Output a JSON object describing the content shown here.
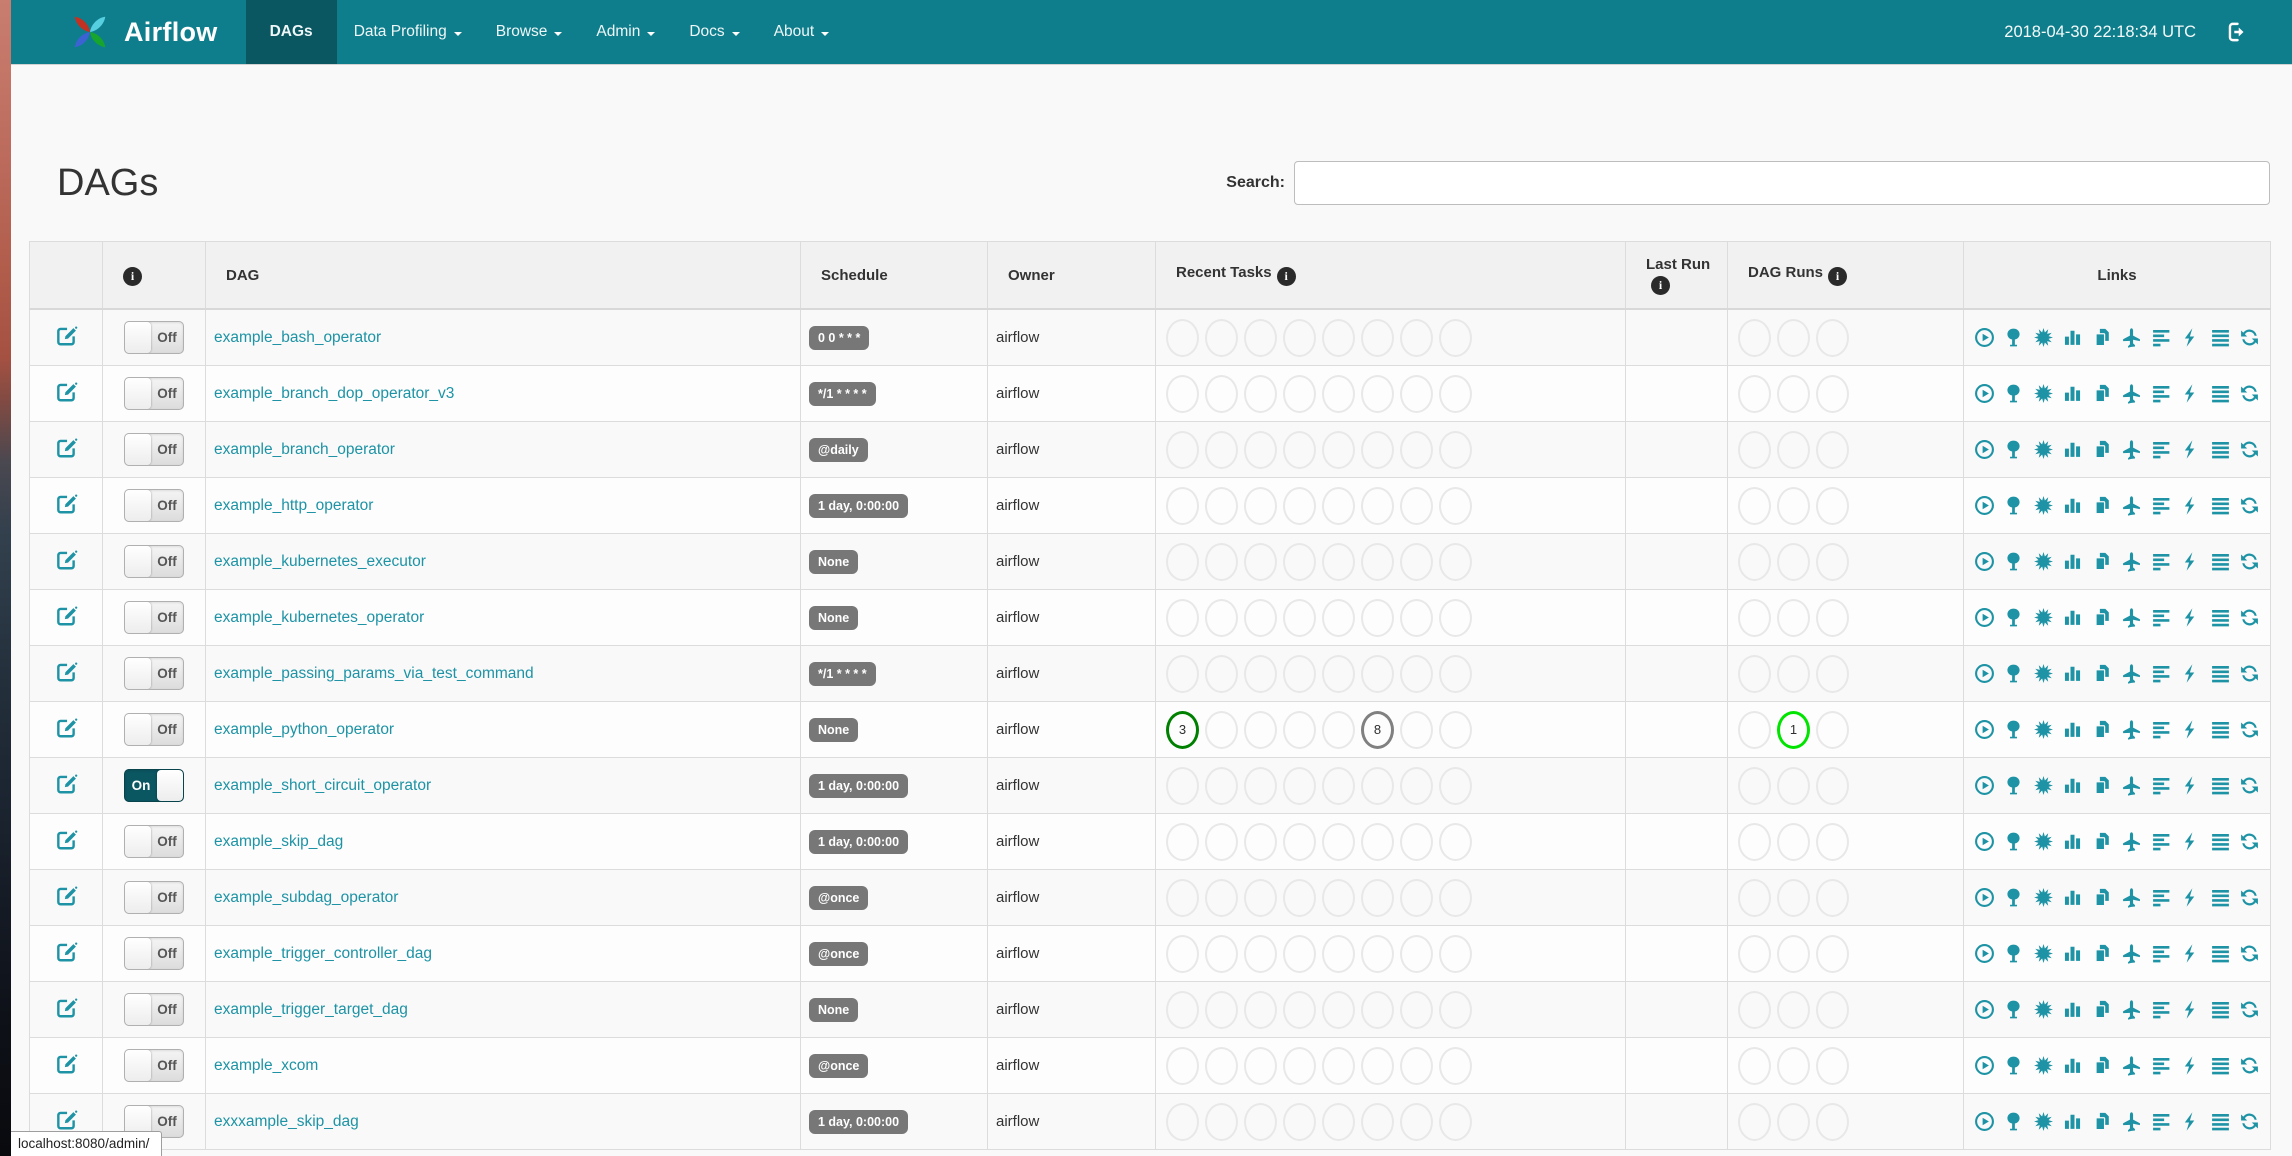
{
  "navbar": {
    "brand": "Airflow",
    "items": [
      {
        "label": "DAGs",
        "active": true,
        "caret": false
      },
      {
        "label": "Data Profiling",
        "active": false,
        "caret": true
      },
      {
        "label": "Browse",
        "active": false,
        "caret": true
      },
      {
        "label": "Admin",
        "active": false,
        "caret": true
      },
      {
        "label": "Docs",
        "active": false,
        "caret": true
      },
      {
        "label": "About",
        "active": false,
        "caret": true
      }
    ],
    "clock": "2018-04-30 22:18:34 UTC"
  },
  "page": {
    "title": "DAGs",
    "search_label": "Search:",
    "search_value": "",
    "status_bar": "localhost:8080/admin/"
  },
  "colors": {
    "success": "#008000",
    "queued": "#808080",
    "running": "#00e400",
    "accent_teal": "#1d93a5",
    "navbar_teal": "#0f7e8c",
    "badge_gray": "#777777"
  },
  "toggle": {
    "on_label": "On",
    "off_label": "Off"
  },
  "table": {
    "columns": [
      {
        "label": "",
        "info": false
      },
      {
        "label": "",
        "info": true
      },
      {
        "label": "DAG",
        "info": false
      },
      {
        "label": "Schedule",
        "info": false
      },
      {
        "label": "Owner",
        "info": false
      },
      {
        "label": "Recent Tasks",
        "info": true
      },
      {
        "label": "Last Run",
        "info": true
      },
      {
        "label": "DAG Runs",
        "info": true
      },
      {
        "label": "Links",
        "info": false,
        "center": true
      }
    ],
    "recent_task_slots": 8,
    "dag_run_slots": 3,
    "link_icons": [
      "trigger-dag-icon",
      "tree-view-icon",
      "graph-view-icon",
      "task-duration-icon",
      "task-tries-icon",
      "landing-times-icon",
      "gantt-view-icon",
      "code-view-icon",
      "logs-icon",
      "refresh-icon"
    ],
    "rows": [
      {
        "dag": "example_bash_operator",
        "schedule": "0 0 * * *",
        "owner": "airflow",
        "on": false,
        "recent": {},
        "runs": {}
      },
      {
        "dag": "example_branch_dop_operator_v3",
        "schedule": "*/1 * * * *",
        "owner": "airflow",
        "on": false,
        "recent": {},
        "runs": {}
      },
      {
        "dag": "example_branch_operator",
        "schedule": "@daily",
        "owner": "airflow",
        "on": false,
        "recent": {},
        "runs": {}
      },
      {
        "dag": "example_http_operator",
        "schedule": "1 day, 0:00:00",
        "owner": "airflow",
        "on": false,
        "recent": {},
        "runs": {}
      },
      {
        "dag": "example_kubernetes_executor",
        "schedule": "None",
        "owner": "airflow",
        "on": false,
        "recent": {},
        "runs": {}
      },
      {
        "dag": "example_kubernetes_operator",
        "schedule": "None",
        "owner": "airflow",
        "on": false,
        "recent": {},
        "runs": {}
      },
      {
        "dag": "example_passing_params_via_test_command",
        "schedule": "*/1 * * * *",
        "owner": "airflow",
        "on": false,
        "recent": {},
        "runs": {}
      },
      {
        "dag": "example_python_operator",
        "schedule": "None",
        "owner": "airflow",
        "on": false,
        "recent": {
          "0": {
            "count": "3",
            "state": "success"
          },
          "5": {
            "count": "8",
            "state": "queued"
          }
        },
        "runs": {
          "1": {
            "count": "1",
            "state": "running"
          }
        }
      },
      {
        "dag": "example_short_circuit_operator",
        "schedule": "1 day, 0:00:00",
        "owner": "airflow",
        "on": true,
        "recent": {},
        "runs": {}
      },
      {
        "dag": "example_skip_dag",
        "schedule": "1 day, 0:00:00",
        "owner": "airflow",
        "on": false,
        "recent": {},
        "runs": {}
      },
      {
        "dag": "example_subdag_operator",
        "schedule": "@once",
        "owner": "airflow",
        "on": false,
        "recent": {},
        "runs": {}
      },
      {
        "dag": "example_trigger_controller_dag",
        "schedule": "@once",
        "owner": "airflow",
        "on": false,
        "recent": {},
        "runs": {}
      },
      {
        "dag": "example_trigger_target_dag",
        "schedule": "None",
        "owner": "airflow",
        "on": false,
        "recent": {},
        "runs": {}
      },
      {
        "dag": "example_xcom",
        "schedule": "@once",
        "owner": "airflow",
        "on": false,
        "recent": {},
        "runs": {}
      },
      {
        "dag": "exxxample_skip_dag",
        "schedule": "1 day, 0:00:00",
        "owner": "airflow",
        "on": false,
        "recent": {},
        "runs": {}
      }
    ]
  }
}
